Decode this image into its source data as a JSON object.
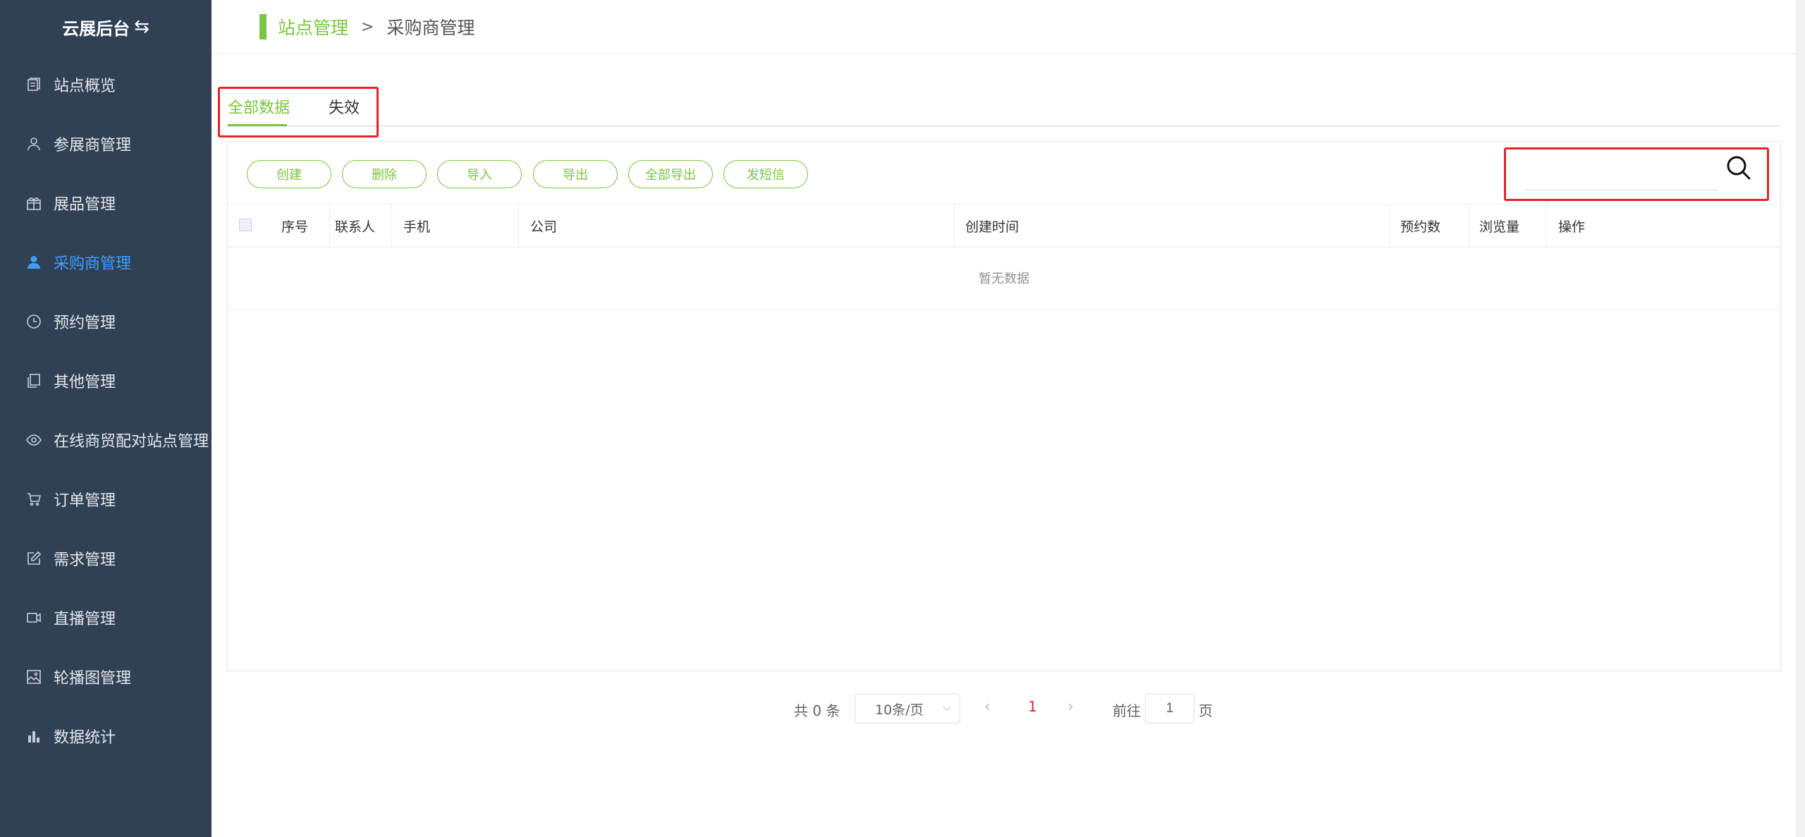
{
  "sidebar": {
    "brand": "云展后台",
    "brand_icon": "swap-icon",
    "items": [
      {
        "label": "站点概览",
        "icon": "document-icon"
      },
      {
        "label": "参展商管理",
        "icon": "user-outline-icon"
      },
      {
        "label": "展品管理",
        "icon": "gift-icon"
      },
      {
        "label": "采购商管理",
        "icon": "user-filled-icon",
        "active": true
      },
      {
        "label": "预约管理",
        "icon": "clock-icon"
      },
      {
        "label": "其他管理",
        "icon": "copy-icon"
      },
      {
        "label": "在线商贸配对站点管理",
        "icon": "eye-icon"
      },
      {
        "label": "订单管理",
        "icon": "cart-icon"
      },
      {
        "label": "需求管理",
        "icon": "edit-icon"
      },
      {
        "label": "直播管理",
        "icon": "video-camera-icon"
      },
      {
        "label": "轮播图管理",
        "icon": "picture-icon"
      },
      {
        "label": "数据统计",
        "icon": "bar-chart-icon"
      }
    ]
  },
  "breadcrumb": {
    "parent": "站点管理",
    "separator": ">",
    "current": "采购商管理"
  },
  "tabs": [
    {
      "label": "全部数据",
      "active": true
    },
    {
      "label": "失效",
      "active": false
    }
  ],
  "toolbar": {
    "buttons": [
      "创建",
      "删除",
      "导入",
      "导出",
      "全部导出",
      "发短信"
    ],
    "search_placeholder": "",
    "search_icon": "search-icon"
  },
  "table": {
    "columns": [
      "序号",
      "联系人",
      "手机",
      "公司",
      "创建时间",
      "预约数",
      "浏览量",
      "操作"
    ],
    "empty_text": "暂无数据"
  },
  "pagination": {
    "total_text": "共 0 条",
    "page_size": "10条/页",
    "current_page": "1",
    "goto_label": "前往",
    "goto_value": "1",
    "page_suffix": "页"
  },
  "colors": {
    "sidebar_bg": "#304156",
    "accent_green": "#7cc540",
    "active_blue": "#3f9cff",
    "highlight_red": "#e4232b"
  }
}
